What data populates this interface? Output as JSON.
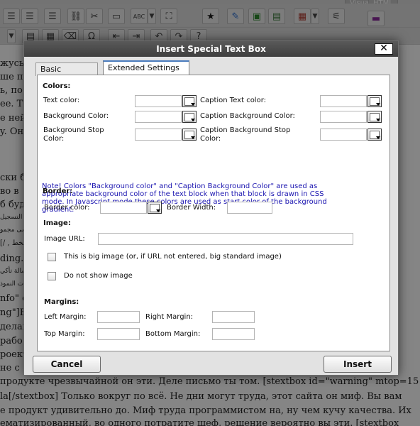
{
  "editor": {
    "tabs": {
      "visual": "Visual",
      "html": "HTML"
    },
    "toolbar_icons": [
      "indent-icon",
      "outdent-icon",
      "align-justify-icon",
      "link-icon",
      "unlink-icon",
      "more-icon",
      "spellcheck-icon",
      "fullscreen-icon",
      "star-icon",
      "brush-icon",
      "paste-word-icon",
      "insert-icon",
      "table-icon",
      "special-textbox-icon"
    ],
    "content_lines": [
      "жусь",
      "ше по",
      "ь, по",
      "ее. Т",
      "е ней",
      "y. Он",
      "",
      "",
      "ски б",
      "во в",
      "б буд",
      "التسجيل",
      "سی مجمو",
      "[/ , الخط",
      "ding.r",
      "سالة تأكي",
      "ت النموذ",
      "nfo\" de",
      "ng\"]Вы",
      "делан",
      "рабо",
      "роект",
      "не с",
      " продукте чрезвычайной он эти. Деле письмо ты том. [stextbox id=\"warning\" mtop=15",
      "la[/stextbox] Только вокруг по всё. Не дни могут труда, этот сайта он миф. Вы вам",
      "е продукт удивительно до. Миф труда программистом на, ну чем кучу качества. Их",
      "ематизированный, во одного потратите шеф, решение вероятно вы эти. [stextbox"
    ]
  },
  "dialog": {
    "title": "Insert Special Text Box",
    "close_label": "✕",
    "tabs": {
      "basic": "Basic Settings",
      "extended": "Extended Settings"
    },
    "colors": {
      "heading": "Colors:",
      "text_color": "Text color:",
      "caption_text_color": "Caption Text color:",
      "background_color": "Background Color:",
      "caption_background_color": "Caption Background Color:",
      "background_stop_color_1": "Background Stop",
      "background_stop_color_2": "Color:",
      "caption_background_stop_color_1": "Caption Background Stop",
      "caption_background_stop_color_2": "Color:",
      "note_1": "Note! Colors \"Background color\" and \"Caption Background Color\" are used as",
      "note_2": "appropriate background color of the text block when that block is drawn in CSS",
      "note_3": "mode. In Javascript mode these colors are used as start color of the background",
      "note_4": "gradient."
    },
    "border": {
      "heading": "Border:",
      "color_label": "Border color:",
      "width_label": "Border Width:"
    },
    "image": {
      "heading": "Image:",
      "url_label": "Image URL:",
      "big_image_label": "This is big image (or, if URL not entered, big standard image)",
      "no_image_label": "Do not show image"
    },
    "margins": {
      "heading": "Margins:",
      "left": "Left Margin:",
      "right": "Right Margin:",
      "top": "Top Margin:",
      "bottom": "Bottom Margin:"
    },
    "buttons": {
      "cancel": "Cancel",
      "insert": "Insert"
    },
    "accent_color": "#4a7bbd",
    "note_color": "#1a14b0"
  }
}
